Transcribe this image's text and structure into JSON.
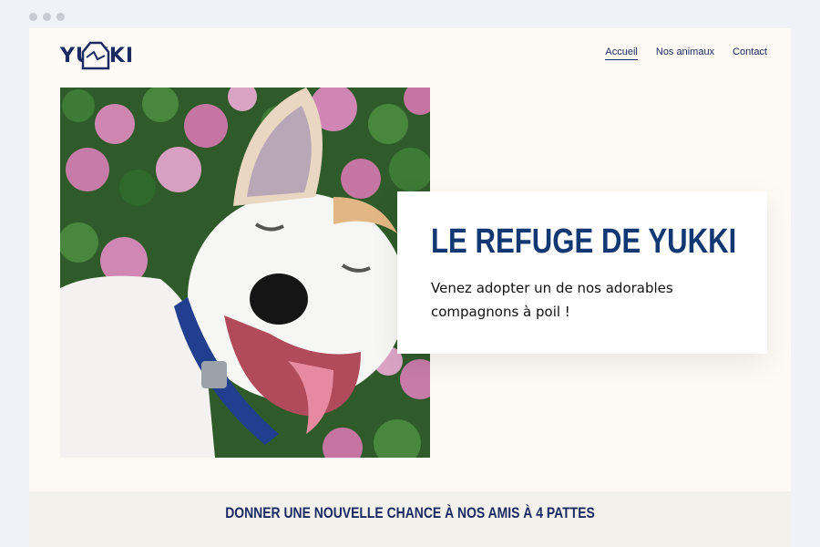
{
  "brand": {
    "logo_text": "YUKKI",
    "colors": {
      "navy": "#123873",
      "nav": "#1c2a63",
      "page_bg": "#fdfaf5"
    }
  },
  "nav": {
    "items": [
      {
        "label": "Accueil"
      },
      {
        "label": "Nos animaux"
      },
      {
        "label": "Contact"
      }
    ]
  },
  "hero": {
    "title": "LE REFUGE DE YUKKI",
    "subtitle": "Venez adopter un de nos adorables compagnons à poil !"
  },
  "section": {
    "title": "DONNER UNE NOUVELLE CHANCE À NOS AMIS À 4 PATTES"
  }
}
